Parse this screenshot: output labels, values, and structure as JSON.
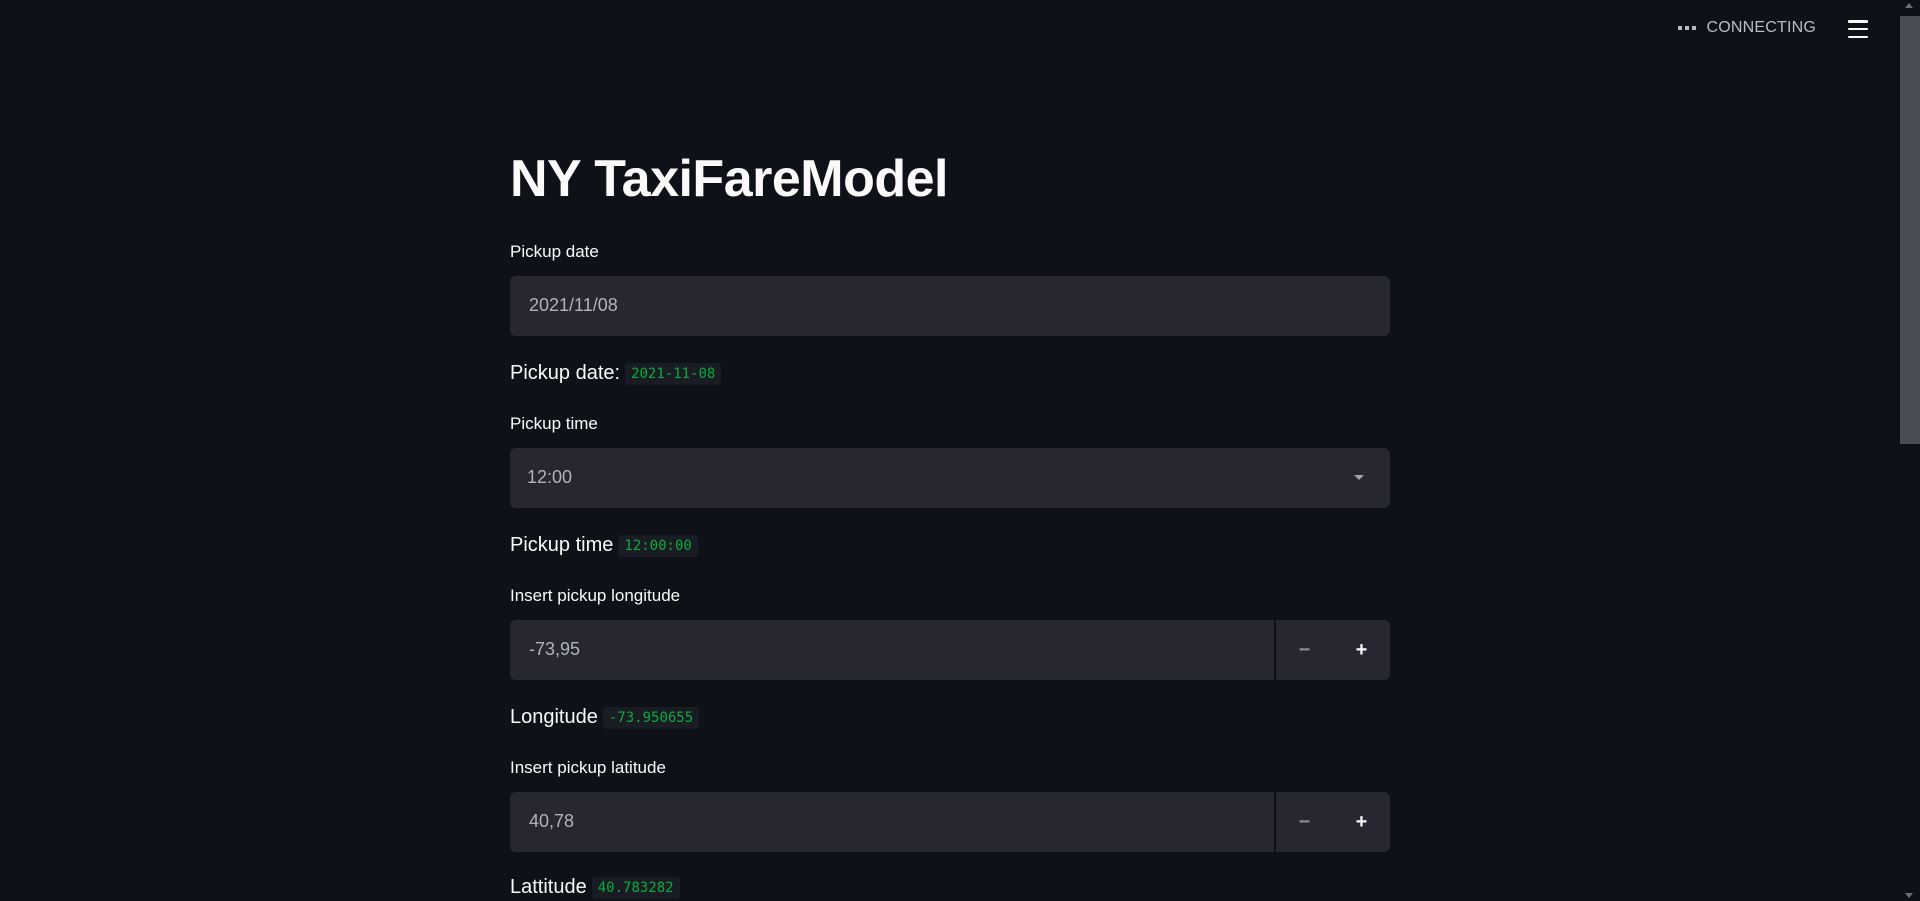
{
  "header": {
    "status_label": "CONNECTING"
  },
  "main": {
    "title": "NY TaxiFareModel",
    "pickup_date": {
      "label": "Pickup date",
      "value": "2021/11/08",
      "output_label": "Pickup date:",
      "output_value": "2021-11-08"
    },
    "pickup_time": {
      "label": "Pickup time",
      "value": "12:00",
      "output_label": "Pickup time",
      "output_value": "12:00:00"
    },
    "longitude": {
      "label": "Insert pickup longitude",
      "value": "-73,95",
      "minus": "−",
      "plus": "+",
      "output_label": "Longitude",
      "output_value": "-73.950655"
    },
    "latitude": {
      "label": "Insert pickup latitude",
      "value": "40,78",
      "minus": "−",
      "plus": "+",
      "output_label": "Lattitude",
      "output_value": "40.783282"
    }
  },
  "colors": {
    "background": "#0e1117",
    "input_bg": "#262730",
    "code_green": "#09ab3b"
  }
}
